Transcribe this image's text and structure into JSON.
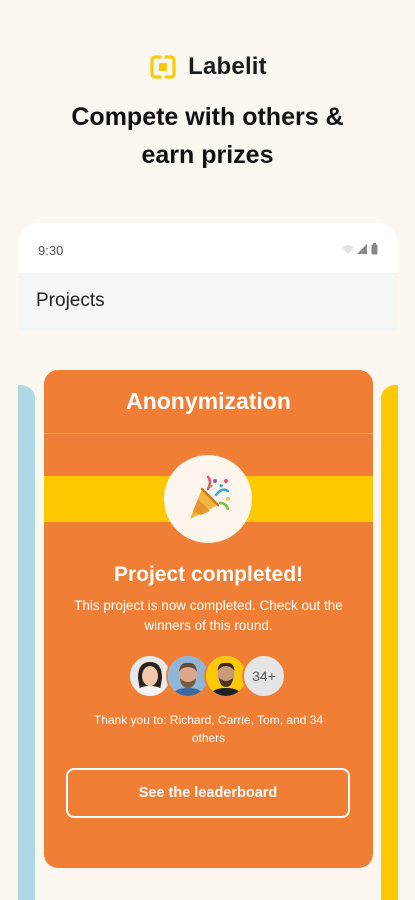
{
  "brand": {
    "name": "Labelit",
    "logo_icon": "labelit-logo-icon",
    "logo_color": "#ffc900"
  },
  "headline": {
    "line1": "Compete with others &",
    "line2": "earn prizes"
  },
  "phone": {
    "status": {
      "time": "9:30",
      "icons": [
        "wifi-icon",
        "signal-icon",
        "battery-icon"
      ]
    },
    "app_bar": {
      "title": "Projects"
    },
    "card": {
      "title": "Anonymization",
      "icon": "party-popper-icon",
      "completed_title": "Project completed!",
      "completed_desc": "This project is now completed. Check out the winners of this round.",
      "avatars": [
        "avatar-woman",
        "avatar-man-beard",
        "avatar-man-yellow"
      ],
      "more_count": "34+",
      "thanks_text": "Thank you to: Richard, Carrie, Tom, and 34 others",
      "leaderboard_button": "See the leaderboard"
    }
  },
  "colors": {
    "card": "#f07f35",
    "accent_yellow": "#ffc900",
    "side_blue": "#add8e6",
    "page_bg": "#fcf8f1"
  }
}
